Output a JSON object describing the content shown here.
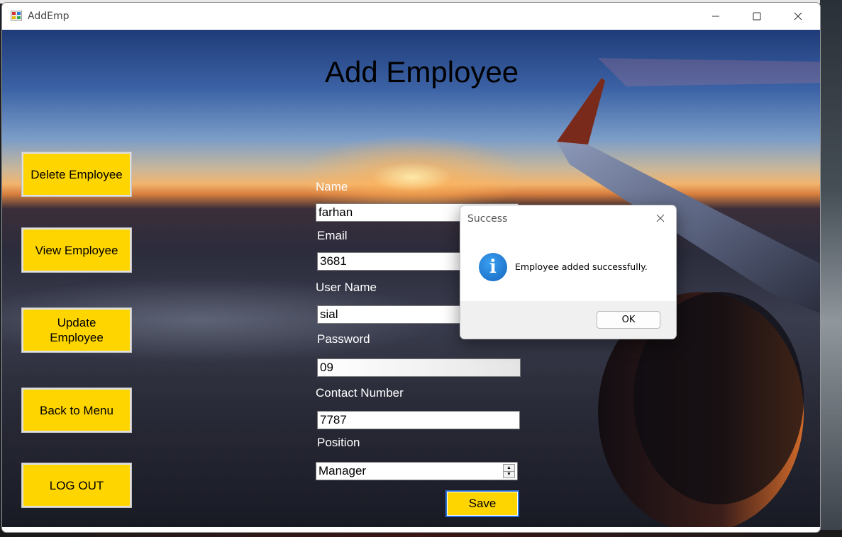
{
  "window": {
    "title": "AddEmp",
    "minimize_glyph": "—",
    "maximize_glyph": "☐",
    "close_glyph": "✕"
  },
  "page": {
    "title": "Add Employee"
  },
  "sidebar": {
    "buttons": [
      {
        "label": "Delete Employee"
      },
      {
        "label": "View Employee"
      },
      {
        "label": "Update Employee"
      },
      {
        "label": "Back to Menu"
      },
      {
        "label": "LOG OUT"
      }
    ]
  },
  "form": {
    "name_label": "Name",
    "name_value": "farhan",
    "email_label": "Email",
    "email_value": "3681",
    "username_label": "User Name",
    "username_value": "sial",
    "password_label": "Password",
    "password_value": "09",
    "contact_label": "Contact Number",
    "contact_value": "7787",
    "position_label": "Position",
    "position_value": "Manager",
    "save_label": "Save"
  },
  "dialog": {
    "title": "Success",
    "message": "Employee added successfully.",
    "ok_label": "OK",
    "icon": "info-icon"
  },
  "colors": {
    "button_yellow": "#ffd500",
    "label_white": "#ffffff"
  }
}
